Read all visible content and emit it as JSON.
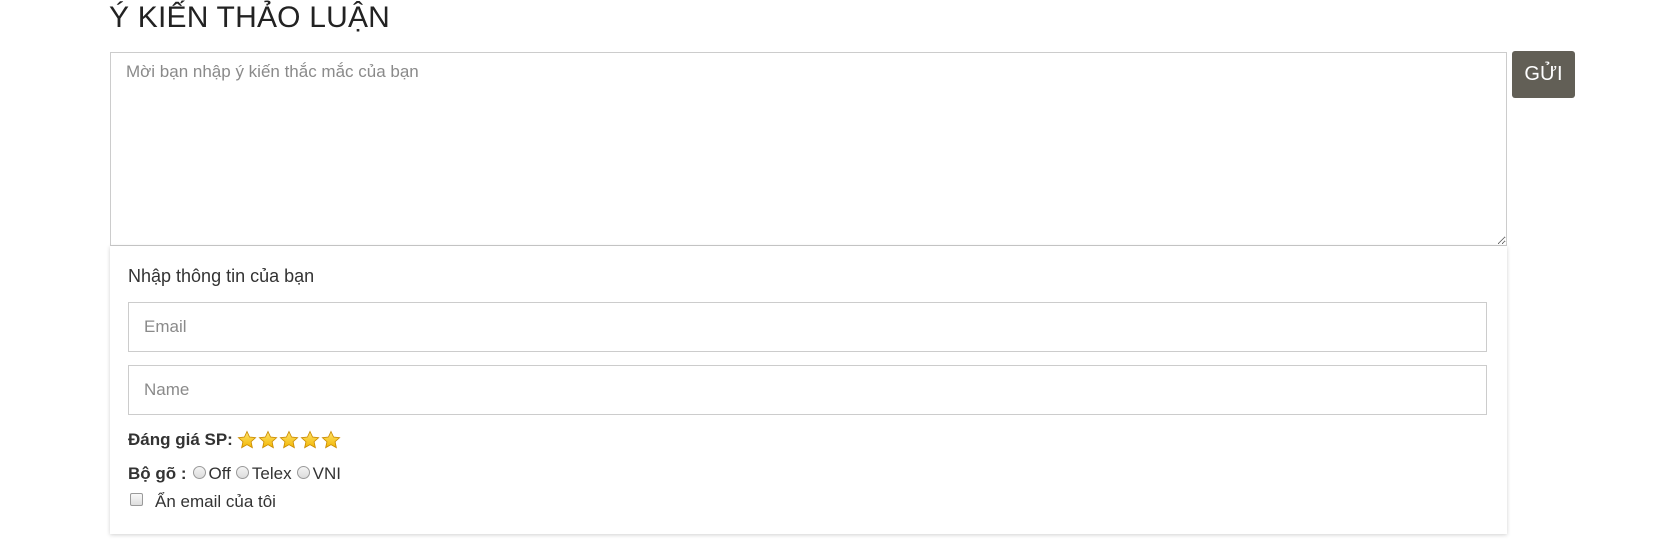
{
  "section": {
    "title": "Ý KIẾN THẢO LUẬN"
  },
  "comment": {
    "placeholder": "Mời bạn nhập ý kiến thắc mắc của bạn",
    "value": ""
  },
  "send_button": {
    "label": "GỬI"
  },
  "info_panel": {
    "heading": "Nhập thông tin của bạn",
    "email_placeholder": "Email",
    "name_placeholder": "Name"
  },
  "rating": {
    "label": "Đáng giá SP:",
    "max_stars": 5,
    "star_color": "#f2b705"
  },
  "input_method": {
    "label": "Bộ gõ :",
    "options": [
      {
        "label": "Off",
        "selected": false
      },
      {
        "label": "Telex",
        "selected": false
      },
      {
        "label": "VNI",
        "selected": false
      }
    ]
  },
  "hide_email": {
    "label": "Ẩn email của tôi",
    "checked": false
  },
  "colors": {
    "send_button_bg": "#625f56",
    "border": "#cccccc",
    "text": "#333333",
    "placeholder": "#8a8a8a"
  }
}
